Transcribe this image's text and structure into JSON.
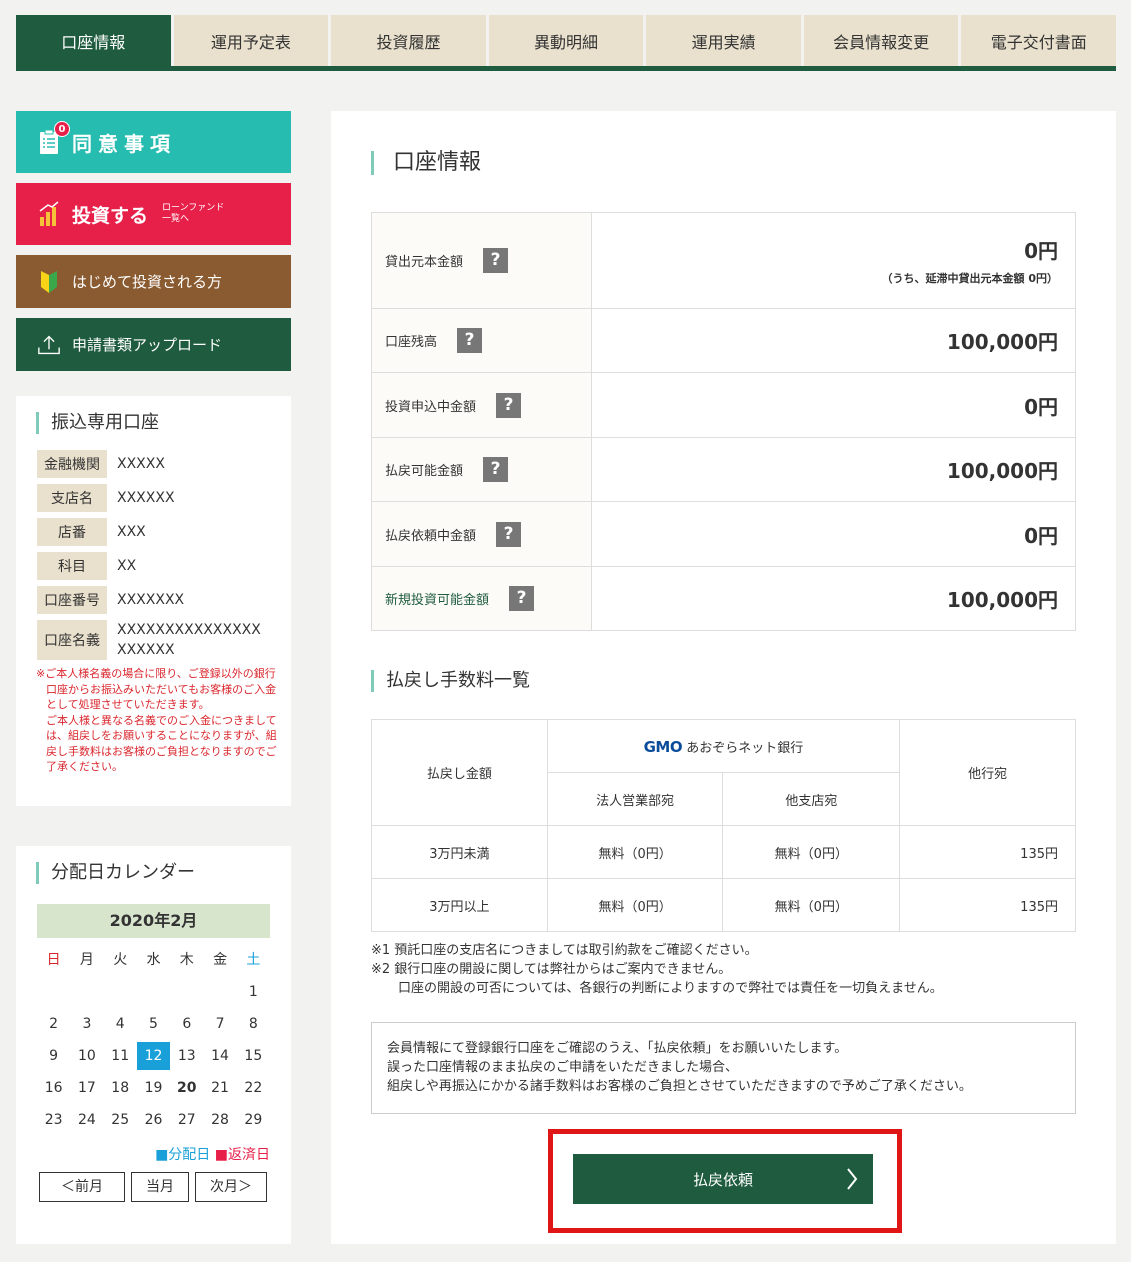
{
  "tabs": [
    "口座情報",
    "運用予定表",
    "投資履歴",
    "異動明細",
    "運用実績",
    "会員情報変更",
    "電子交付書面"
  ],
  "sidebar": {
    "agree": {
      "label": "同意事項",
      "badge": "0"
    },
    "invest": {
      "label": "投資する",
      "sub1": "ローンファンド",
      "sub2": "一覧へ"
    },
    "first_time": "はじめて投資される方",
    "upload": "申請書類アップロード"
  },
  "transfer": {
    "title": "振込専用口座",
    "rows": [
      {
        "label": "金融機関",
        "value": "XXXXX"
      },
      {
        "label": "支店名",
        "value": "XXXXXX"
      },
      {
        "label": "店番",
        "value": "XXX"
      },
      {
        "label": "科目",
        "value": "XX"
      },
      {
        "label": "口座番号",
        "value": "XXXXXXX"
      },
      {
        "label": "口座名義",
        "value": "XXXXXXXXXXXXXXXXXXXXX"
      }
    ],
    "note1": "※ご本人様名義の場合に限り、ご登録以外の銀行口座からお振込みいただいてもお客様のご入金として処理させていただきます。",
    "note2": "ご本人様と異なる名義でのご入金につきましては、組戻しをお願いすることになりますが、組戻し手数料はお客様のご負担となりますのでご了承ください。"
  },
  "calendar": {
    "title": "分配日カレンダー",
    "month": "2020年2月",
    "weekdays": [
      "日",
      "月",
      "火",
      "水",
      "木",
      "金",
      "土"
    ],
    "days": [
      "",
      "",
      "",
      "",
      "",
      "",
      "1",
      "2",
      "3",
      "4",
      "5",
      "6",
      "7",
      "8",
      "9",
      "10",
      "11",
      "12",
      "13",
      "14",
      "15",
      "16",
      "17",
      "18",
      "19",
      "20",
      "21",
      "22",
      "23",
      "24",
      "25",
      "26",
      "27",
      "28",
      "29"
    ],
    "distribution_day": "12",
    "repayment_day": "20",
    "legend_dist": "■分配日",
    "legend_repay": "■返済日",
    "prev": "＜前月",
    "current": "当月",
    "next": "次月＞"
  },
  "account": {
    "title": "口座情報",
    "rows": [
      {
        "label": "貸出元本金額",
        "value": "0円",
        "sub": "（うち、延滞中貸出元本金額 0円）"
      },
      {
        "label": "口座残高",
        "value": "100,000円"
      },
      {
        "label": "投資申込中金額",
        "value": "0円"
      },
      {
        "label": "払戻可能金額",
        "value": "100,000円"
      },
      {
        "label": "払戻依頼中金額",
        "value": "0円"
      },
      {
        "label": "新規投資可能金額",
        "value": "100,000円"
      }
    ],
    "help": "?"
  },
  "fees": {
    "title": "払戻し手数料一覧",
    "col_amount": "払戻し金額",
    "bank_logo": "GMO",
    "bank_name": "あおぞらネット銀行",
    "col_corp": "法人営業部宛",
    "col_branch": "他支店宛",
    "col_other": "他行宛",
    "rows": [
      {
        "amount": "3万円未満",
        "corp": "無料（0円）",
        "branch": "無料（0円）",
        "other": "135円"
      },
      {
        "amount": "3万円以上",
        "corp": "無料（0円）",
        "branch": "無料（0円）",
        "other": "135円"
      }
    ]
  },
  "notes": [
    "※1 預託口座の支店名につきましては取引約款をご確認ください。",
    "※2 銀行口座の開設に関しては弊社からはご案内できません。",
    "口座の開設の可否については、各銀行の判断によりますので弊社では責任を一切負えません。"
  ],
  "notice": [
    "会員情報にて登録銀行口座をご確認のうえ、「払戻依頼」をお願いいたします。",
    "誤った口座情報のまま払戻のご申請をいただきました場合、",
    "組戻しや再振込にかかる諸手数料はお客様のご負担とさせていただきますので予めご了承ください。"
  ],
  "submit_label": "払戻依頼",
  "colors": {
    "green": "#1f5c3f",
    "teal": "#26bcb0",
    "red": "#e7204a",
    "brown": "#8a5a30",
    "beige": "#e9e1cd",
    "blue": "#1aa0d8"
  }
}
